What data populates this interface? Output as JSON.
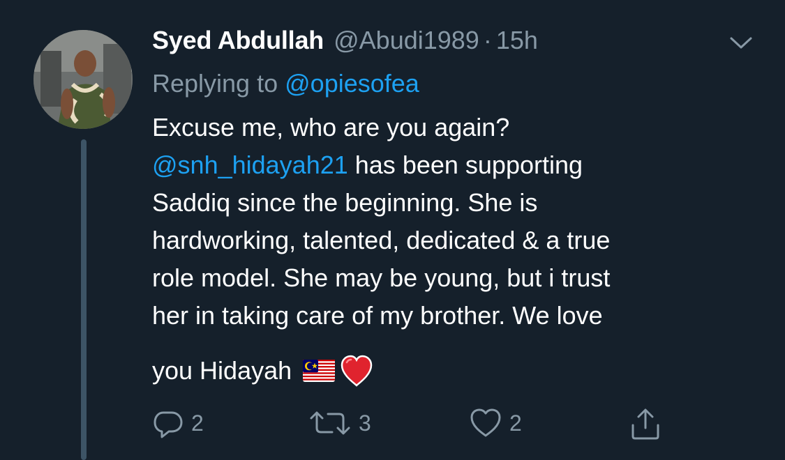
{
  "author": {
    "name": "Syed Abdullah",
    "handle": "@Abudi1989",
    "separator": "·",
    "time": "15h"
  },
  "reply": {
    "prefix": "Replying to",
    "to": "@opiesofea"
  },
  "tweet": {
    "line1": "Excuse me, who are you again?",
    "line2_mention": "@snh_hidayah21",
    "line2_rest": " has been supporting",
    "line3": "Saddiq since the beginning. She is",
    "line4": "hardworking, talented, dedicated & a true",
    "line5": "role model. She may be young, but i trust",
    "line6": "her in taking care of my brother. We love",
    "line7": "you Hidayah"
  },
  "actions": {
    "replies": "2",
    "retweets": "3",
    "likes": "2"
  },
  "icons": {
    "menu": "chevron-down-icon",
    "reply": "reply-icon",
    "retweet": "retweet-icon",
    "like": "like-icon",
    "share": "share-icon",
    "flag": "malaysia-flag-icon",
    "heart": "red-heart-icon"
  },
  "colors": {
    "background": "#15202b",
    "text": "#ffffff",
    "muted": "#8899a6",
    "link": "#1da1f2",
    "thread_line": "#3d5466"
  }
}
